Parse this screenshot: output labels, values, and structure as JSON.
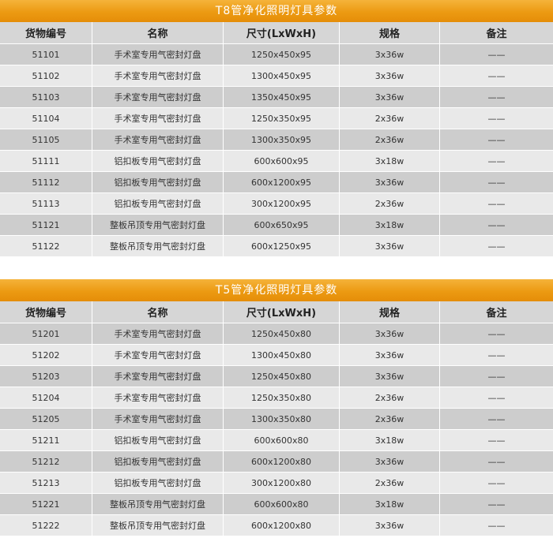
{
  "tables": [
    {
      "title": "T8管净化照明灯具参数",
      "headers": [
        "货物编号",
        "名称",
        "尺寸(LxWxH)",
        "规格",
        "备注"
      ],
      "rows": [
        [
          "51101",
          "手术室专用气密封灯盘",
          "1250x450x95",
          "3x36w",
          "——"
        ],
        [
          "51102",
          "手术室专用气密封灯盘",
          "1300x450x95",
          "3x36w",
          "——"
        ],
        [
          "51103",
          "手术室专用气密封灯盘",
          "1350x450x95",
          "3x36w",
          "——"
        ],
        [
          "51104",
          "手术室专用气密封灯盘",
          "1250x350x95",
          "2x36w",
          "——"
        ],
        [
          "51105",
          "手术室专用气密封灯盘",
          "1300x350x95",
          "2x36w",
          "——"
        ],
        [
          "51111",
          "铝扣板专用气密封灯盘",
          "600x600x95",
          "3x18w",
          "——"
        ],
        [
          "51112",
          "铝扣板专用气密封灯盘",
          "600x1200x95",
          "3x36w",
          "——"
        ],
        [
          "51113",
          "铝扣板专用气密封灯盘",
          "300x1200x95",
          "2x36w",
          "——"
        ],
        [
          "51121",
          "整板吊顶专用气密封灯盘",
          "600x650x95",
          "3x18w",
          "——"
        ],
        [
          "51122",
          "整板吊顶专用气密封灯盘",
          "600x1250x95",
          "3x36w",
          "——"
        ]
      ]
    },
    {
      "title": "T5管净化照明灯具参数",
      "headers": [
        "货物编号",
        "名称",
        "尺寸(LxWxH)",
        "规格",
        "备注"
      ],
      "rows": [
        [
          "51201",
          "手术室专用气密封灯盘",
          "1250x450x80",
          "3x36w",
          "——"
        ],
        [
          "51202",
          "手术室专用气密封灯盘",
          "1300x450x80",
          "3x36w",
          "——"
        ],
        [
          "51203",
          "手术室专用气密封灯盘",
          "1250x450x80",
          "3x36w",
          "——"
        ],
        [
          "51204",
          "手术室专用气密封灯盘",
          "1250x350x80",
          "2x36w",
          "——"
        ],
        [
          "51205",
          "手术室专用气密封灯盘",
          "1300x350x80",
          "2x36w",
          "——"
        ],
        [
          "51211",
          "铝扣板专用气密封灯盘",
          "600x600x80",
          "3x18w",
          "——"
        ],
        [
          "51212",
          "铝扣板专用气密封灯盘",
          "600x1200x80",
          "3x36w",
          "——"
        ],
        [
          "51213",
          "铝扣板专用气密封灯盘",
          "300x1200x80",
          "2x36w",
          "——"
        ],
        [
          "51221",
          "整板吊顶专用气密封灯盘",
          "600x600x80",
          "3x18w",
          "——"
        ],
        [
          "51222",
          "整板吊顶专用气密封灯盘",
          "600x1200x80",
          "3x36w",
          "——"
        ]
      ]
    }
  ],
  "colors": {
    "title_bar": "#ec9a12",
    "header_bg": "#d6d6d6",
    "row_dark": "#cdcdcd",
    "row_light": "#e9e9e9"
  }
}
